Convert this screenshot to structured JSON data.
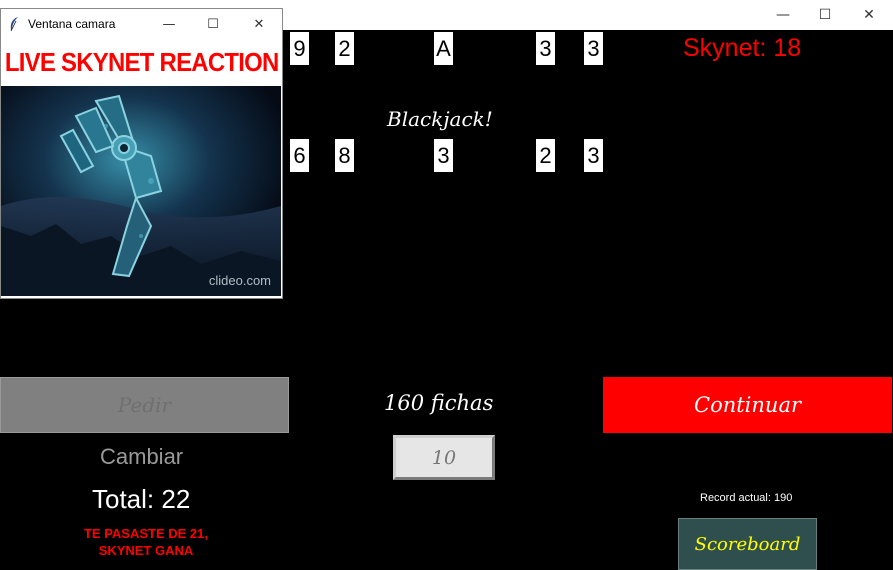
{
  "main_window": {
    "controls": {
      "minimize": "—",
      "maximize": "☐",
      "close": "✕"
    }
  },
  "skynet_cards": [
    "9",
    "2",
    "A",
    "3",
    "3"
  ],
  "player_cards": [
    "6",
    "8",
    "3",
    "2",
    "3"
  ],
  "skynet_score": "Skynet: 18",
  "message": "Blackjack!",
  "buttons": {
    "pedir": "Pedir",
    "continuar": "Continuar",
    "cambiar": "Cambiar",
    "scoreboard": "Scoreboard"
  },
  "fichas": "160 fichas",
  "bet_value": "10",
  "total": "Total: 22",
  "result_message": {
    "line1": "TE PASASTE DE 21,",
    "line2": "SKYNET GANA"
  },
  "record": "Record actual: 190",
  "camera_window": {
    "title": "Ventana camara",
    "header": "LIVE SKYNET REACTION",
    "watermark": "clideo.com",
    "controls": {
      "minimize": "—",
      "maximize": "☐",
      "close": "✕"
    }
  },
  "colors": {
    "background": "#000000",
    "accent_red": "#ff0000",
    "pedir_disabled": "#808080",
    "scoreboard_bg": "#2f4f4f",
    "scoreboard_text": "#ffff00"
  }
}
